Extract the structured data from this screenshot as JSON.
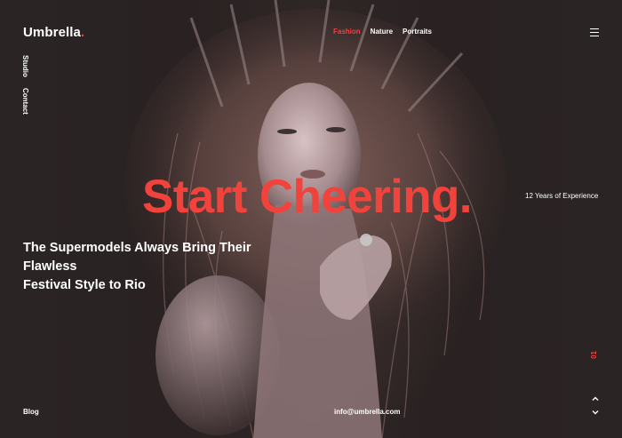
{
  "brand": {
    "name": "Umbrella",
    "dot": "."
  },
  "nav": {
    "items": [
      "Fashion",
      "Nature",
      "Portraits"
    ],
    "active": "Fashion"
  },
  "menu": {
    "icon": "hamburger-menu-icon"
  },
  "side_nav": {
    "items": [
      "Studio",
      "Contact"
    ]
  },
  "hero": {
    "headline": "Start Cheering.",
    "subhead_line1": "The Supermodels Always Bring Their Flawless",
    "subhead_line2": "Festival Style to Rio",
    "experience": "12 Years of Experience",
    "slide_number": "01",
    "image_subject": "portrait of model with voluminous curly hair and headpiece"
  },
  "footer": {
    "blog": "Blog",
    "email": "info@umbrella.com"
  },
  "controls": {
    "up_icon": "chevron-up-icon",
    "down_icon": "chevron-down-icon"
  },
  "colors": {
    "accent": "#f2423c",
    "background": "#2a2323",
    "text": "#ffffff"
  }
}
